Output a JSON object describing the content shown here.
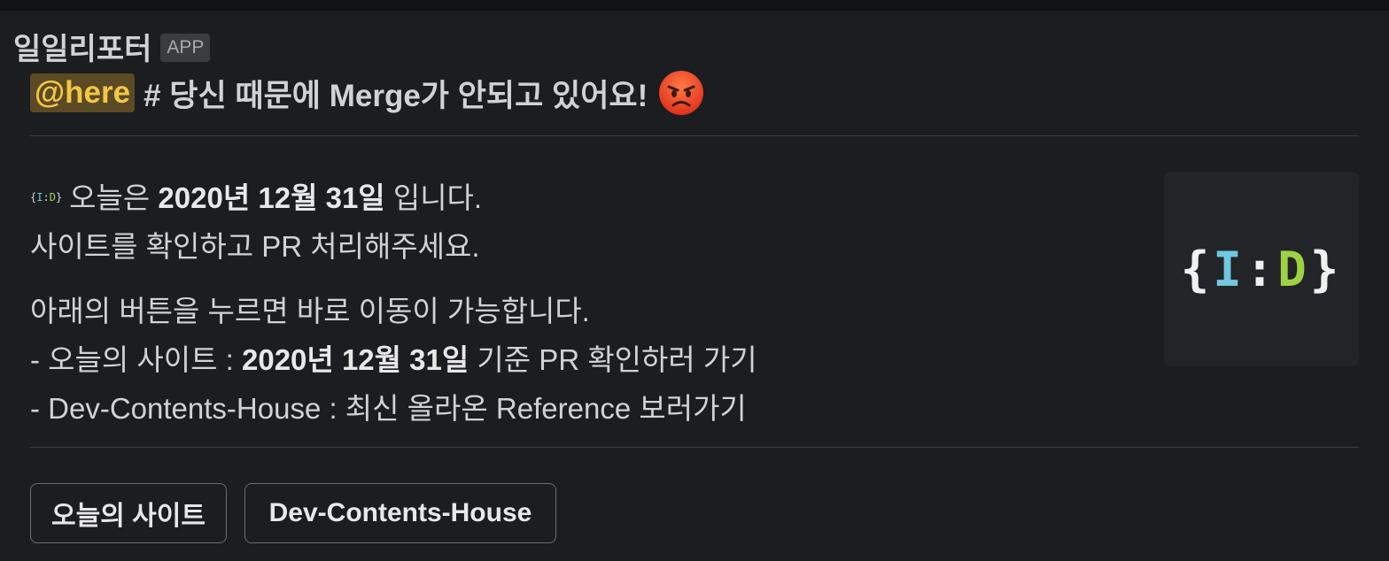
{
  "message": {
    "sender": "일일리포터",
    "app_badge": "APP",
    "mention": "@here",
    "headline": "# 당신 때문에 Merge가 안되고 있어요!",
    "emoji": "angry-face"
  },
  "body": {
    "logo_text": {
      "open": "{",
      "i": "I",
      "colon": ":",
      "d": "D",
      "close": "}"
    },
    "line1_prefix": "오늘은 ",
    "line1_date": "2020년 12월 31일",
    "line1_suffix": " 입니다.",
    "line2": "사이트를 확인하고 PR 처리해주세요.",
    "line3": "아래의 버튼을 누르면 바로 이동이 가능합니다.",
    "line4_prefix": " - 오늘의 사이트 : ",
    "line4_date": "2020년 12월 31일",
    "line4_suffix": " 기준 PR 확인하러 가기",
    "line5": " - Dev-Contents-House : 최신 올라온 Reference 보러가기"
  },
  "colors": {
    "background": "#1b1d21",
    "mention_bg": "#5c4a25",
    "mention_fg": "#f2c744",
    "logo_i": "#6fc7e0",
    "logo_d": "#9fd243"
  },
  "buttons": {
    "today_site": "오늘의 사이트",
    "dev_contents_house": "Dev-Contents-House"
  }
}
